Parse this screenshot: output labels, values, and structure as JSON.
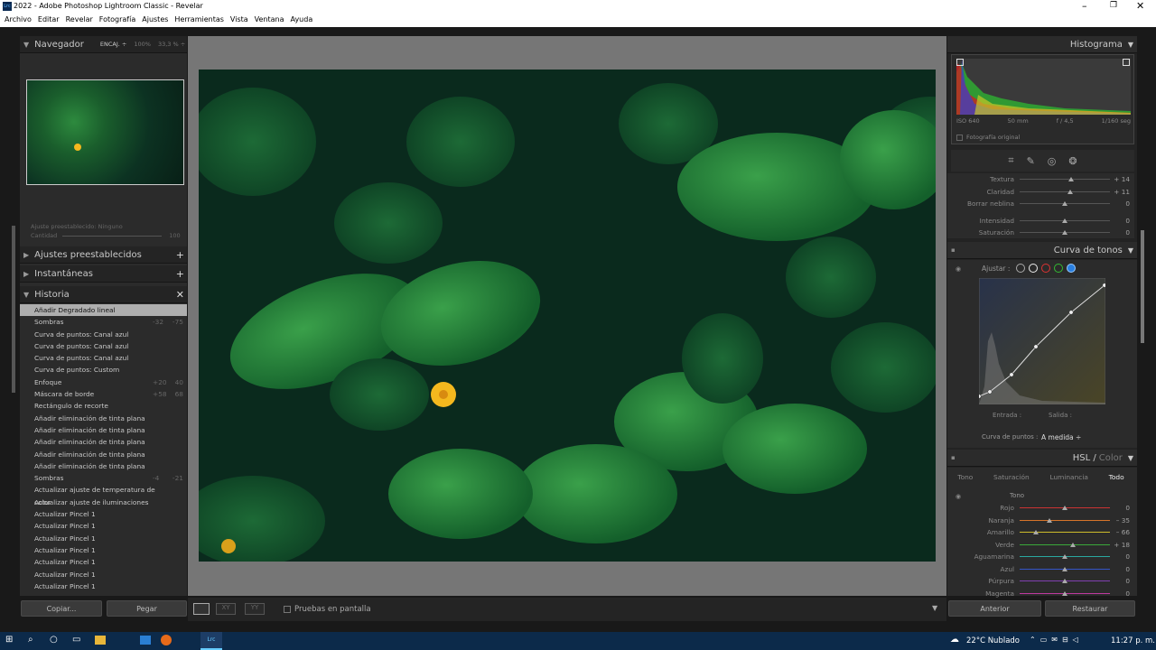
{
  "window": {
    "title": "2022 - Adobe Photoshop Lightroom Classic - Revelar",
    "app_icon": "Lrc"
  },
  "menu": [
    "Archivo",
    "Editar",
    "Revelar",
    "Fotografía",
    "Ajustes",
    "Herramientas",
    "Vista",
    "Ventana",
    "Ayuda"
  ],
  "navigator": {
    "title": "Navegador",
    "fit": "ENCAJ. ÷",
    "z1": "100%",
    "z2": "33,3 % ÷"
  },
  "preset": {
    "label": "Ajuste preestablecido:",
    "value": "Ninguno",
    "amount_label": "Cantidad",
    "amount": "100"
  },
  "panels": {
    "presets": "Ajustes preestablecidos",
    "snapshots": "Instantáneas",
    "history": "Historia"
  },
  "history": [
    {
      "label": "Añadir Degradado lineal",
      "a": "",
      "b": "",
      "selected": true
    },
    {
      "label": "Sombras",
      "a": "-32",
      "b": "-75"
    },
    {
      "label": "Curva de puntos: Canal azul",
      "a": "",
      "b": ""
    },
    {
      "label": "Curva de puntos: Canal azul",
      "a": "",
      "b": ""
    },
    {
      "label": "Curva de puntos: Canal azul",
      "a": "",
      "b": ""
    },
    {
      "label": "Curva de puntos: Custom",
      "a": "",
      "b": ""
    },
    {
      "label": "Enfoque",
      "a": "+20",
      "b": "40"
    },
    {
      "label": "Máscara de borde",
      "a": "+58",
      "b": "68"
    },
    {
      "label": "Rectángulo de recorte",
      "a": "",
      "b": ""
    },
    {
      "label": "Añadir eliminación de tinta plana",
      "a": "",
      "b": ""
    },
    {
      "label": "Añadir eliminación de tinta plana",
      "a": "",
      "b": ""
    },
    {
      "label": "Añadir eliminación de tinta plana",
      "a": "",
      "b": ""
    },
    {
      "label": "Añadir eliminación de tinta plana",
      "a": "",
      "b": ""
    },
    {
      "label": "Añadir eliminación de tinta plana",
      "a": "",
      "b": ""
    },
    {
      "label": "Sombras",
      "a": "-4",
      "b": "-21"
    },
    {
      "label": "Actualizar ajuste de temperatura de color",
      "a": "",
      "b": ""
    },
    {
      "label": "Actualizar ajuste de iluminaciones",
      "a": "",
      "b": ""
    },
    {
      "label": "Actualizar Pincel 1",
      "a": "",
      "b": ""
    },
    {
      "label": "Actualizar Pincel 1",
      "a": "",
      "b": ""
    },
    {
      "label": "Actualizar Pincel 1",
      "a": "",
      "b": ""
    },
    {
      "label": "Actualizar Pincel 1",
      "a": "",
      "b": ""
    },
    {
      "label": "Actualizar Pincel 1",
      "a": "",
      "b": ""
    },
    {
      "label": "Actualizar Pincel 1",
      "a": "",
      "b": ""
    },
    {
      "label": "Actualizar Pincel 1",
      "a": "",
      "b": ""
    }
  ],
  "left_buttons": {
    "copy": "Copiar...",
    "paste": "Pegar"
  },
  "toolbar": {
    "softproof": "Pruebas en pantalla"
  },
  "histogram": {
    "title": "Histograma",
    "iso": "ISO 640",
    "focal": "50 mm",
    "aperture": "f / 4,5",
    "shutter": "1/160 seg",
    "original": "Fotografía original"
  },
  "presence": [
    {
      "label": "Textura",
      "value": "+ 14",
      "pos": 0.57
    },
    {
      "label": "Claridad",
      "value": "+ 11",
      "pos": 0.56
    },
    {
      "label": "Borrar neblina",
      "value": "0",
      "pos": 0.5
    },
    {
      "label": "Intensidad",
      "value": "0",
      "pos": 0.5
    },
    {
      "label": "Saturación",
      "value": "0",
      "pos": 0.5
    }
  ],
  "tone_curve": {
    "title": "Curva de tonos",
    "adjust": "Ajustar :",
    "input": "Entrada :",
    "output": "Salida :",
    "point_curve_label": "Curva de puntos :",
    "point_curve_value": "A medida ÷"
  },
  "hsl": {
    "title": "HSL /",
    "title2": "Color",
    "tabs": [
      "Tono",
      "Saturación",
      "Luminancia",
      "Todo"
    ],
    "group": "Tono"
  },
  "hsl_rows": [
    {
      "label": "Rojo",
      "value": "0",
      "pos": 0.5,
      "color": "#c33"
    },
    {
      "label": "Naranja",
      "value": "– 35",
      "pos": 0.33,
      "color": "#d7742a"
    },
    {
      "label": "Amarillo",
      "value": "– 66",
      "pos": 0.18,
      "color": "#cdbd2b"
    },
    {
      "label": "Verde",
      "value": "+ 18",
      "pos": 0.59,
      "color": "#3aa83a"
    },
    {
      "label": "Aguamarina",
      "value": "0",
      "pos": 0.5,
      "color": "#2aa8a0"
    },
    {
      "label": "Azul",
      "value": "0",
      "pos": 0.5,
      "color": "#3555c8"
    },
    {
      "label": "Púrpura",
      "value": "0",
      "pos": 0.5,
      "color": "#8040b0"
    },
    {
      "label": "Magenta",
      "value": "0",
      "pos": 0.5,
      "color": "#c03aa0"
    }
  ],
  "right_buttons": {
    "prev": "Anterior",
    "reset": "Restaurar"
  },
  "taskbar": {
    "weather": "22°C Nublado",
    "time": "11:27 p. m."
  }
}
